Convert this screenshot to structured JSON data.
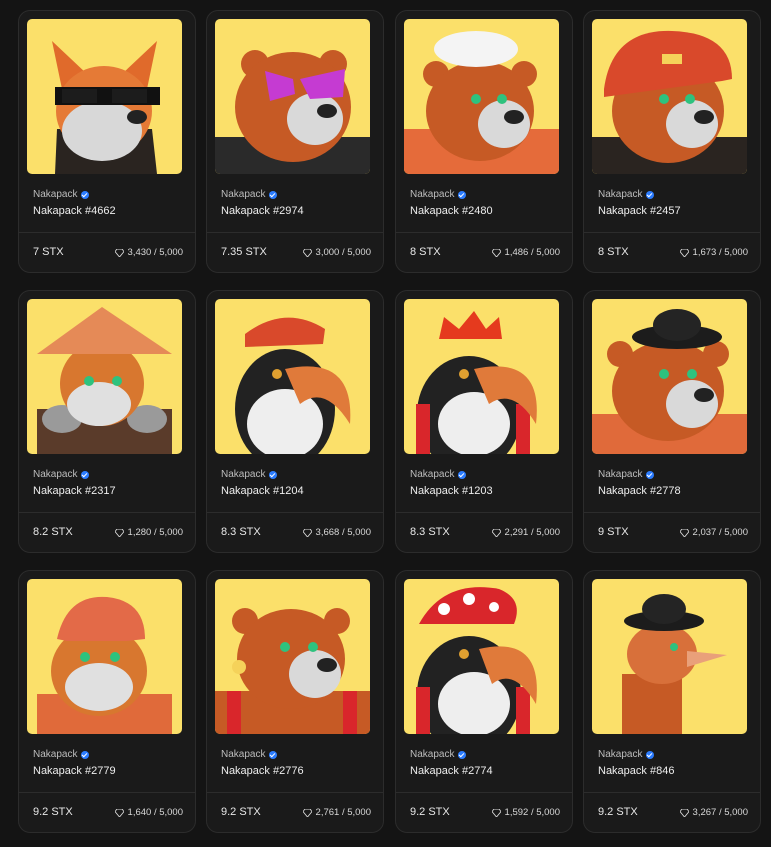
{
  "cards": [
    {
      "collection": "Nakapack",
      "name": "Nakapack #4662",
      "price": "7 STX",
      "supply": "3,430 / 5,000",
      "art": "fox"
    },
    {
      "collection": "Nakapack",
      "name": "Nakapack #2974",
      "price": "7.35 STX",
      "supply": "3,000 / 5,000",
      "art": "bear-shades"
    },
    {
      "collection": "Nakapack",
      "name": "Nakapack #2480",
      "price": "8 STX",
      "supply": "1,486 / 5,000",
      "art": "bear-chef"
    },
    {
      "collection": "Nakapack",
      "name": "Nakapack #2457",
      "price": "8 STX",
      "supply": "1,673 / 5,000",
      "art": "bear-helmet"
    },
    {
      "collection": "Nakapack",
      "name": "Nakapack #2317",
      "price": "8.2 STX",
      "supply": "1,280 / 5,000",
      "art": "cat-straw-hat"
    },
    {
      "collection": "Nakapack",
      "name": "Nakapack #1204",
      "price": "8.3 STX",
      "supply": "3,668 / 5,000",
      "art": "toucan-cap"
    },
    {
      "collection": "Nakapack",
      "name": "Nakapack #1203",
      "price": "8.3 STX",
      "supply": "2,291 / 5,000",
      "art": "toucan-crown"
    },
    {
      "collection": "Nakapack",
      "name": "Nakapack #2778",
      "price": "9 STX",
      "supply": "2,037 / 5,000",
      "art": "bear-bowler"
    },
    {
      "collection": "Nakapack",
      "name": "Nakapack #2779",
      "price": "9.2 STX",
      "supply": "1,640 / 5,000",
      "art": "cat-knight"
    },
    {
      "collection": "Nakapack",
      "name": "Nakapack #2776",
      "price": "9.2 STX",
      "supply": "2,761 / 5,000",
      "art": "bear-overalls"
    },
    {
      "collection": "Nakapack",
      "name": "Nakapack #2774",
      "price": "9.2 STX",
      "supply": "1,592 / 5,000",
      "art": "toucan-mushroom"
    },
    {
      "collection": "Nakapack",
      "name": "Nakapack #846",
      "price": "9.2 STX",
      "supply": "3,267 / 5,000",
      "art": "ostrich-bowler"
    }
  ],
  "colors": {
    "background": "#141414",
    "card": "#1a1a1a",
    "thumb_bg": "#fbe06a",
    "verified": "#2b7cff"
  },
  "icons": {
    "verified": "verified-badge-icon",
    "supply": "diamond-icon"
  }
}
